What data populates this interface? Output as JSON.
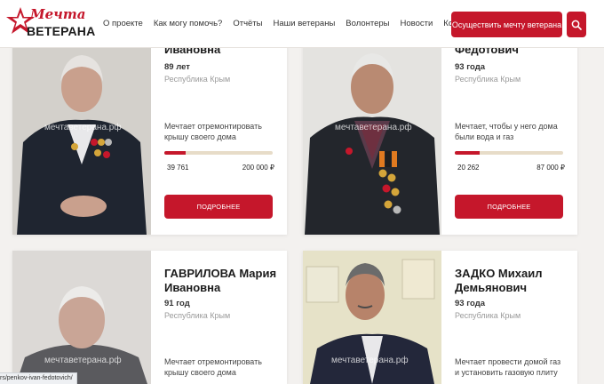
{
  "header": {
    "logo_script": "Мечта",
    "logo_caps": "ВЕТЕРАНА",
    "nav": [
      "О проекте",
      "Как могу помочь?",
      "Отчёты",
      "Наши ветераны",
      "Волонтеры",
      "Новости",
      "Контакты"
    ],
    "cta_label": "Осуществить мечту ветерана",
    "search_icon": "search-icon"
  },
  "colors": {
    "accent": "#c5172b",
    "progress_track": "#e7dcc8",
    "region": "#9a9a9a"
  },
  "cards": [
    {
      "name_line1": "",
      "name_line2": "Ивановна",
      "age": "89 лет",
      "region": "Республика Крым",
      "watermark": "мечтаветерана.рф",
      "dream": "Мечтает отремонтировать крышу своего дома",
      "raised": "39 761",
      "goal": "200 000 ₽",
      "progress": 0.2,
      "button": "ПОДРОБНЕЕ"
    },
    {
      "name_line1": "",
      "name_line2": "Федотович",
      "age": "93 года",
      "region": "Республика Крым",
      "watermark": "мечтаветерана.рф",
      "dream": "Мечтает, чтобы у него дома были вода и газ",
      "raised": "20 262",
      "goal": "87 000 ₽",
      "progress": 0.23,
      "button": "ПОДРОБНЕЕ"
    },
    {
      "name_line1": "ГАВРИЛОВА Мария",
      "name_line2": "Ивановна",
      "age": "91 год",
      "region": "Республика Крым",
      "watermark": "мечтаветерана.рф",
      "dream": "Мечтает отремонтировать крышу своего дома"
    },
    {
      "name_line1": "ЗАДКО Михаил",
      "name_line2": "Демьянович",
      "age": "93 года",
      "region": "Республика Крым",
      "watermark": "мечтаветерана.рф",
      "dream": "Мечтает провести домой газ и установить газовую плиту"
    }
  ],
  "status_url": "rs/penkov-ivan-fedotovich/"
}
